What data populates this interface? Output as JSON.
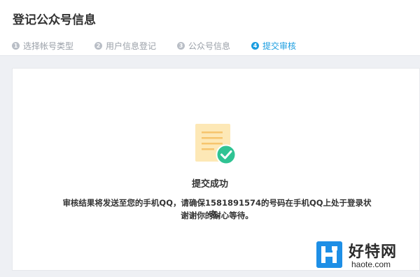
{
  "header": {
    "title": "登记公众号信息"
  },
  "steps": [
    {
      "num": "1",
      "label": "选择帐号类型",
      "active": false
    },
    {
      "num": "2",
      "label": "用户信息登记",
      "active": false
    },
    {
      "num": "3",
      "label": "公众号信息",
      "active": false
    },
    {
      "num": "4",
      "label": "提交审核",
      "active": true
    }
  ],
  "result": {
    "icon": "document-check-icon",
    "title": "提交成功",
    "message_line1": "审核结果将发送至您的手机QQ，请确保1581891574的号码在手机QQ上处于登录状态。",
    "message_line2": "谢谢你的耐心等待。"
  },
  "watermark": {
    "text_cn": "好特网",
    "text_en": "haote.com",
    "logo_color": "#1e8fe6"
  },
  "colors": {
    "accent": "#1a9de0",
    "success": "#2fc393",
    "doc": "#fde8b6"
  }
}
